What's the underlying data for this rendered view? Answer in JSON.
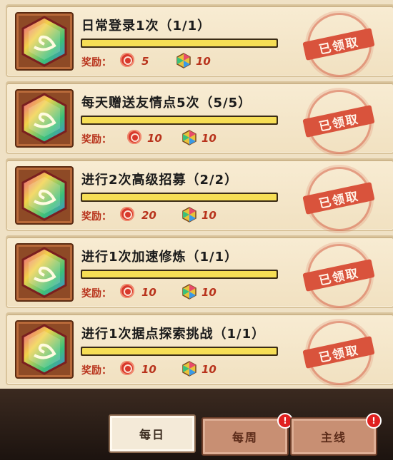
{
  "tasks": [
    {
      "title": "日常登录1次（1/1）",
      "progress": 1.0,
      "reward_label": "奖励：",
      "reward_coin": "5",
      "reward_gem": "10",
      "stamp": "已领取"
    },
    {
      "title": "每天赠送友情点5次（5/5）",
      "progress": 1.0,
      "reward_label": "奖励：",
      "reward_coin": "10",
      "reward_gem": "10",
      "stamp": "已领取"
    },
    {
      "title": "进行2次高级招募（2/2）",
      "progress": 1.0,
      "reward_label": "奖励：",
      "reward_coin": "20",
      "reward_gem": "10",
      "stamp": "已领取"
    },
    {
      "title": "进行1次加速修炼（1/1）",
      "progress": 1.0,
      "reward_label": "奖励：",
      "reward_coin": "10",
      "reward_gem": "10",
      "stamp": "已领取"
    },
    {
      "title": "进行1次据点探索挑战（1/1）",
      "progress": 1.0,
      "reward_label": "奖励：",
      "reward_coin": "10",
      "reward_gem": "10",
      "stamp": "已领取"
    }
  ],
  "tabs": [
    {
      "label": "每日",
      "active": true,
      "badge": ""
    },
    {
      "label": "每周",
      "active": false,
      "badge": "!"
    },
    {
      "label": "主线",
      "active": false,
      "badge": "!"
    }
  ],
  "icons": {
    "task": "leaf-crystal-icon",
    "coin": "red-coin-icon",
    "gem": "rainbow-gem-icon"
  }
}
